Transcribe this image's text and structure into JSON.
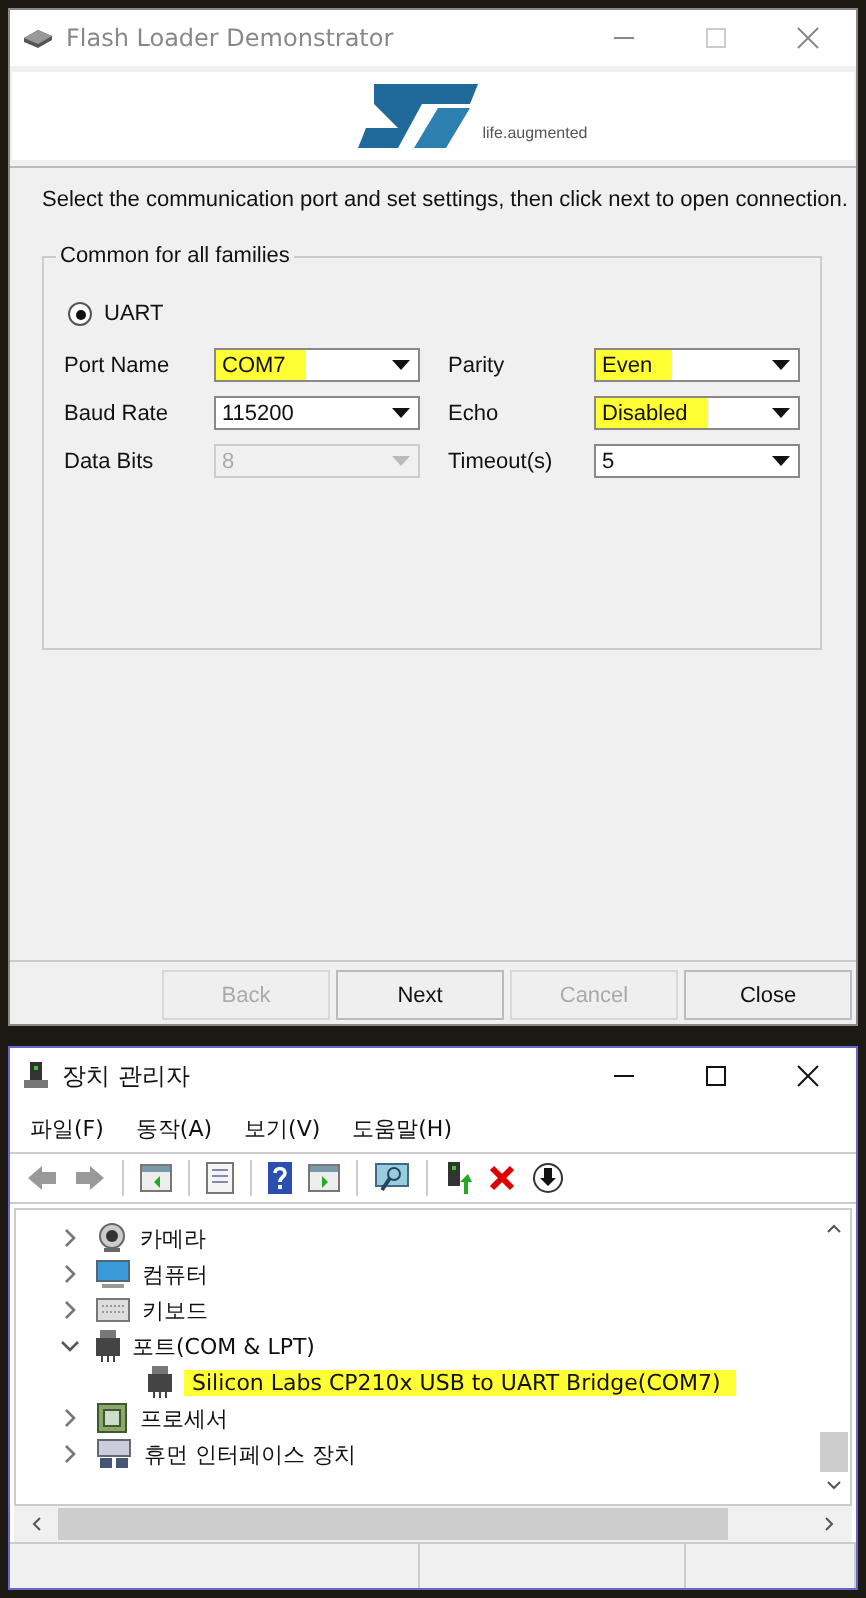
{
  "loader": {
    "title": "Flash Loader Demonstrator",
    "logo_tagline": "life.augmented",
    "instruction": "Select the communication port and set settings, then click next to open connection.",
    "group": {
      "title": "Common for all families",
      "radio": {
        "label": "UART",
        "selected": true
      },
      "left_fields": [
        {
          "label": "Port Name",
          "value": "COM7",
          "disabled": false,
          "highlighted": true
        },
        {
          "label": "Baud Rate",
          "value": "115200",
          "disabled": false,
          "highlighted": false
        },
        {
          "label": "Data Bits",
          "value": "8",
          "disabled": true,
          "highlighted": false
        }
      ],
      "right_fields": [
        {
          "label": "Parity",
          "value": "Even",
          "disabled": false,
          "highlighted": true
        },
        {
          "label": "Echo",
          "value": "Disabled",
          "disabled": false,
          "highlighted": true
        },
        {
          "label": "Timeout(s)",
          "value": "5",
          "disabled": false,
          "highlighted": false
        }
      ]
    },
    "buttons": [
      {
        "label": "Back",
        "disabled": true
      },
      {
        "label": "Next",
        "disabled": false
      },
      {
        "label": "Cancel",
        "disabled": true
      },
      {
        "label": "Close",
        "disabled": false
      }
    ]
  },
  "devmgr": {
    "title": "장치 관리자",
    "menu": [
      "파일(F)",
      "동작(A)",
      "보기(V)",
      "도움말(H)"
    ],
    "tree": [
      {
        "label": "카메라",
        "kind": "camera",
        "expanded": false,
        "highlighted": false
      },
      {
        "label": "컴퓨터",
        "kind": "monitor",
        "expanded": false,
        "highlighted": false
      },
      {
        "label": "키보드",
        "kind": "keyboard",
        "expanded": false,
        "highlighted": false
      },
      {
        "label": "포트(COM & LPT)",
        "kind": "port",
        "expanded": true,
        "highlighted": false,
        "children": [
          {
            "label": "Silicon Labs CP210x USB to UART Bridge(COM7)",
            "kind": "port",
            "highlighted": true
          }
        ]
      },
      {
        "label": "프로세서",
        "kind": "chip",
        "expanded": false,
        "highlighted": false
      },
      {
        "label": "휴먼 인터페이스 장치",
        "kind": "hid",
        "expanded": false,
        "highlighted": false
      }
    ]
  }
}
